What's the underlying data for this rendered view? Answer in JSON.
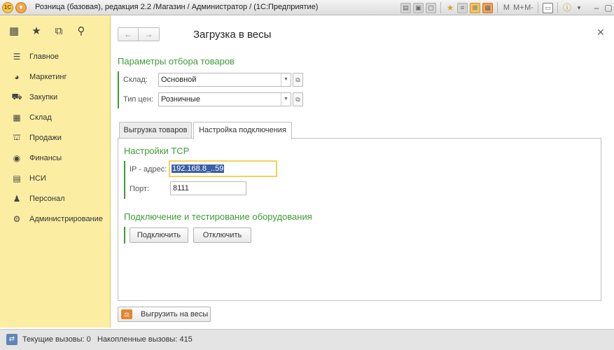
{
  "window": {
    "title": "Розница (базовая), редакция 2.2 /Магазин / Администратор /  (1С:Предприятие)",
    "app_badge": "1С",
    "toolbar_m_labels": [
      "M",
      "M+",
      "M-"
    ]
  },
  "sidebar": {
    "items": [
      {
        "label": "Главное",
        "icon": "menu-icon"
      },
      {
        "label": "Маркетинг",
        "icon": "pie-chart-icon"
      },
      {
        "label": "Закупки",
        "icon": "cart-icon"
      },
      {
        "label": "Склад",
        "icon": "warehouse-icon"
      },
      {
        "label": "Продажи",
        "icon": "basket-icon"
      },
      {
        "label": "Финансы",
        "icon": "coin-icon"
      },
      {
        "label": "НСИ",
        "icon": "list-icon"
      },
      {
        "label": "Персонал",
        "icon": "person-icon"
      },
      {
        "label": "Администрирование",
        "icon": "gear-icon"
      }
    ]
  },
  "form": {
    "title": "Загрузка в весы",
    "filter_section": {
      "title": "Параметры отбора товаров",
      "warehouse_label": "Склад:",
      "warehouse_value": "Основной",
      "price_type_label": "Тип цен:",
      "price_type_value": "Розничные"
    },
    "tabs": [
      {
        "label": "Выгрузка товаров",
        "active": false
      },
      {
        "label": "Настройка подключения",
        "active": true
      }
    ],
    "tcp": {
      "title": "Настройки TCP",
      "ip_label": "IP - адрес:",
      "ip_value": "192.168.8_..59",
      "port_label": "Порт:",
      "port_value": "8111"
    },
    "connection": {
      "title": "Подключение и тестирование оборудования",
      "connect_label": "Подключить",
      "disconnect_label": "Отключить"
    },
    "upload_label": "Выгрузить на весы"
  },
  "status": {
    "text": "Текущие вызовы: 0   Накопленные вызовы: 415"
  },
  "colors": {
    "sidebar_bg": "#fbeea3",
    "accent_green": "#3d9b35",
    "ip_highlight": "#f2d25a",
    "selection": "#3c5fa5"
  }
}
